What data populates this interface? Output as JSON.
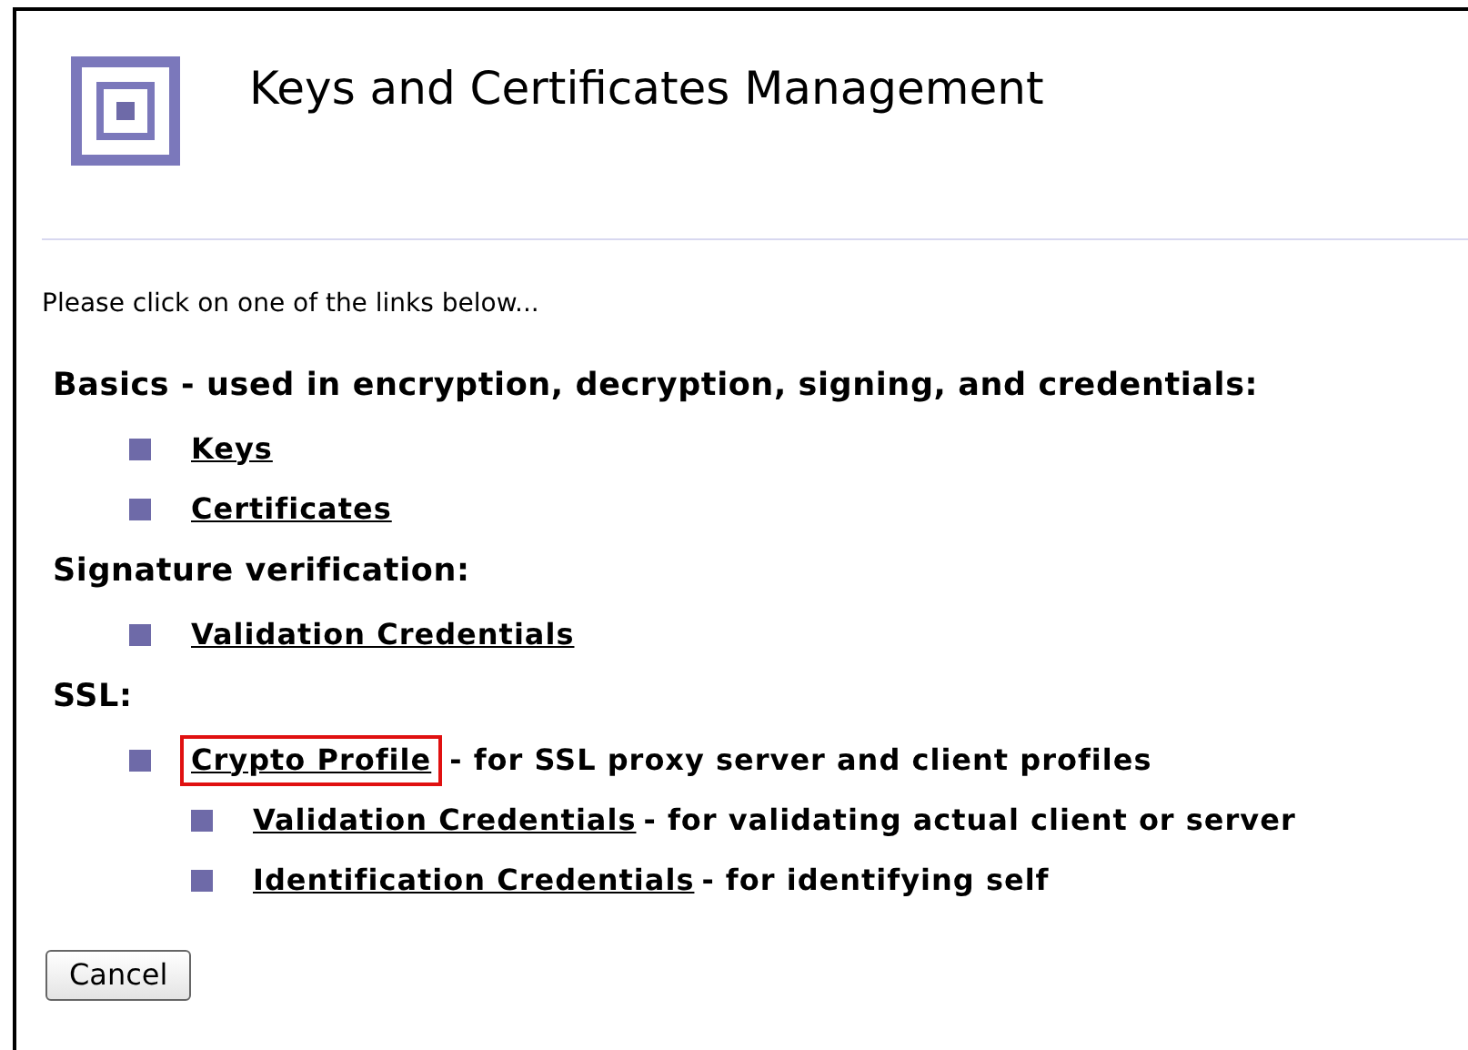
{
  "title": "Keys and Certificates Management",
  "intro": "Please click on one of the links below...",
  "sections": [
    {
      "heading": "Basics - used in encryption, decryption, signing, and credentials:",
      "items": [
        {
          "link": "Keys",
          "highlighted": false
        },
        {
          "link": "Certificates",
          "highlighted": false
        }
      ]
    },
    {
      "heading": "Signature verification:",
      "items": [
        {
          "link": "Validation Credentials",
          "highlighted": false
        }
      ]
    },
    {
      "heading": "SSL:",
      "items": [
        {
          "link": "Crypto Profile ",
          "note": "- for SSL proxy server and client profiles",
          "highlighted": true,
          "children": [
            {
              "link": "Validation Credentials ",
              "note": "- for validating actual client or server",
              "highlighted": false
            },
            {
              "link": "Identification Credentials ",
              "note": "- for identifying self",
              "highlighted": false
            }
          ]
        }
      ]
    }
  ],
  "button": "Cancel"
}
